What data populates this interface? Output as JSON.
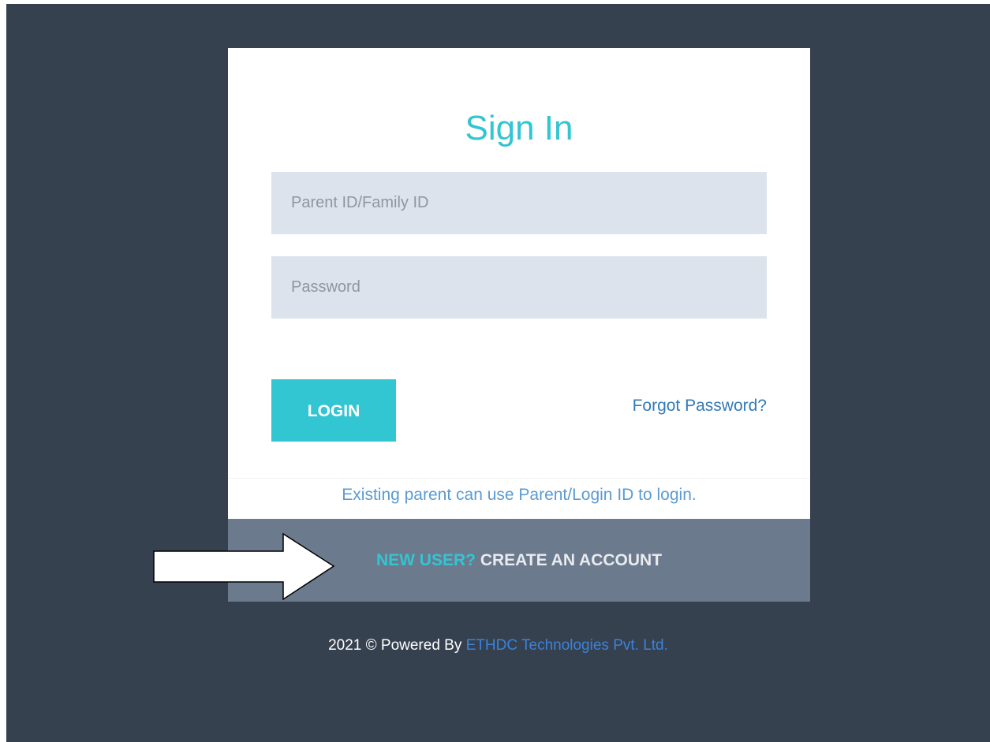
{
  "signin": {
    "title": "Sign In",
    "parent_id_placeholder": "Parent ID/Family ID",
    "password_placeholder": "Password",
    "login_label": "LOGIN",
    "forgot_label": "Forgot Password?",
    "existing_note": "Existing parent can use Parent/Login ID to login."
  },
  "create": {
    "new_user_label": "NEW USER?",
    "create_label": "CREATE AN ACCOUNT"
  },
  "footer": {
    "prefix": "2021 © Powered By",
    "company": "ETHDC Technologies Pvt. Ltd."
  },
  "colors": {
    "background": "#364150",
    "accent": "#32c5d2",
    "link": "#337ab7",
    "create_bar": "#6c7a8d",
    "input_bg": "#dde3ec"
  },
  "icons": {
    "annotation": "right-arrow-icon"
  }
}
